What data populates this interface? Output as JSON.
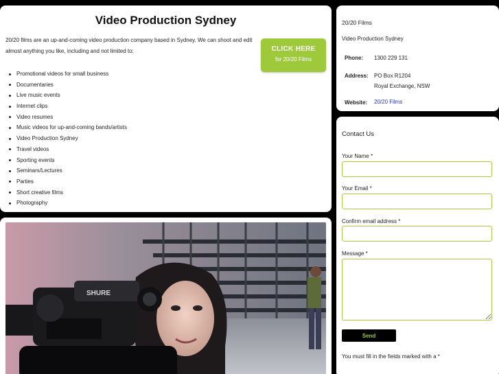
{
  "main": {
    "title": "Video Production Sydney",
    "intro": "20/20 films are an up-and-coming video production company based in Sydney. We can shoot and edit almost anything you like, including and not limited to:",
    "services": [
      "Promotional videos for small business",
      "Documentaries",
      "Live music events",
      "Internet clips",
      "Video resumes",
      "Music videos for up-and-coming bands/artists",
      "Video Production Sydney",
      "Travel videos",
      "Sporting events",
      "Seminars/Lectures",
      "Parties",
      "Short creative films",
      "Photography"
    ]
  },
  "cta": {
    "title": "CLICK HERE",
    "subtitle": "for 20/20 Films"
  },
  "photo": {
    "camera_brand": "SHURE"
  },
  "info": {
    "company": "20/20 Films",
    "tagline": "Video Production Sydney",
    "phone_label": "Phone:",
    "phone": "1300 229 131",
    "address_label": "Address:",
    "address_line1": "PO Box R1204",
    "address_line2": "Royal Exchange, NSW",
    "website_label": "Website:",
    "website": "20/20 Films"
  },
  "contact": {
    "title": "Contact Us",
    "name_label": "Your Name *",
    "name_value": "",
    "email_label": "Your Email *",
    "email_value": "",
    "confirm_label": "Confirm email address *",
    "confirm_value": "",
    "message_label": "Message *",
    "message_value": "",
    "send_label": "Send",
    "required_note": "You must fill in the fields marked with a *"
  },
  "colors": {
    "accent": "#9dc93a",
    "background": "#000000",
    "panel": "#ffffff",
    "link": "#2233dd"
  }
}
